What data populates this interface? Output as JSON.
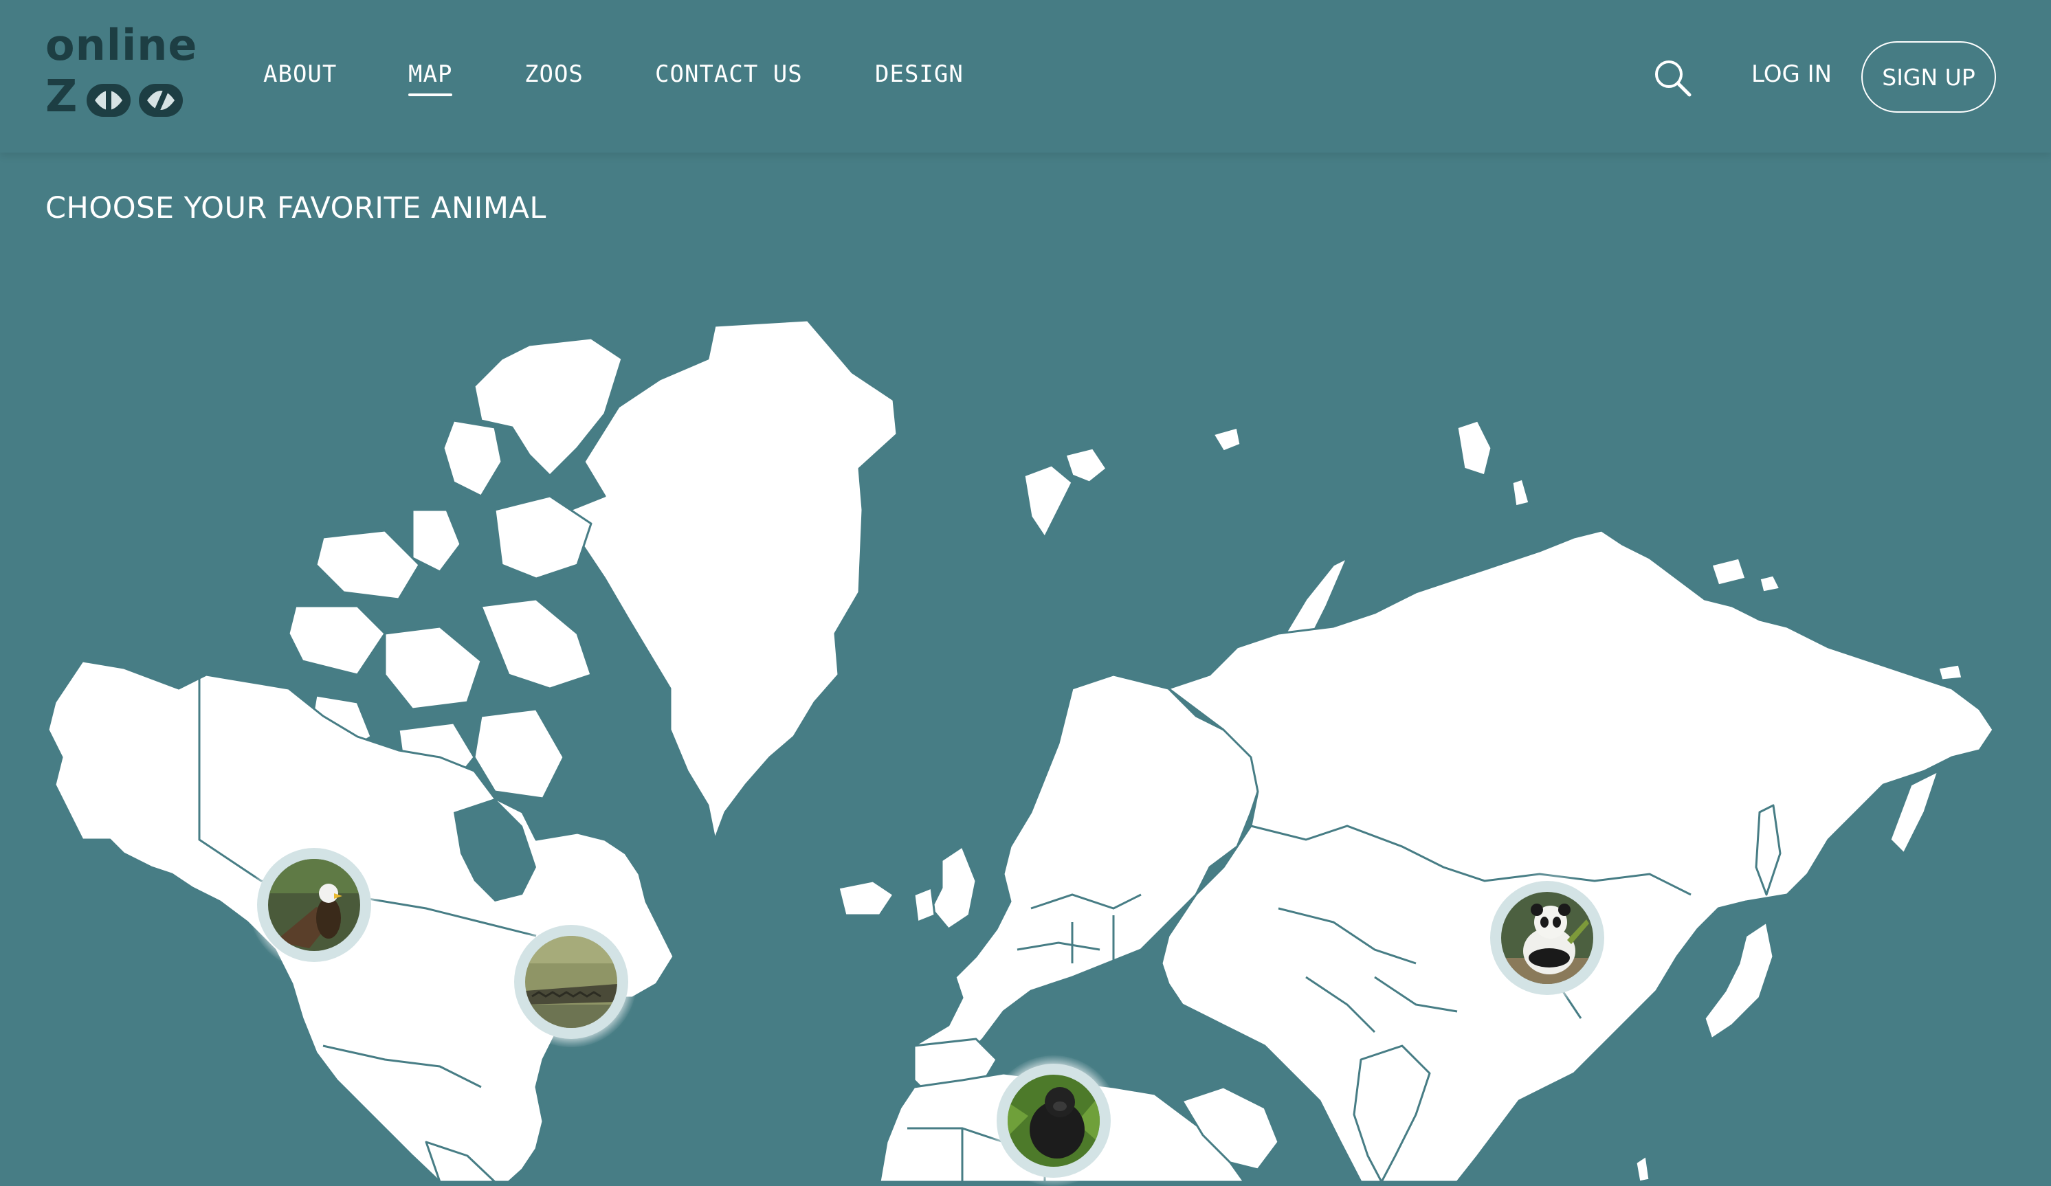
{
  "brand": {
    "word": "online",
    "mark_letter": "Z"
  },
  "nav": {
    "items": [
      {
        "label": "ABOUT",
        "active": false
      },
      {
        "label": "MAP",
        "active": true
      },
      {
        "label": "ZOOS",
        "active": false
      },
      {
        "label": "CONTACT US",
        "active": false
      },
      {
        "label": "DESIGN",
        "active": false
      }
    ]
  },
  "header_actions": {
    "search_icon": "search-icon",
    "login_label": "LOG IN",
    "signup_label": "SIGN UP"
  },
  "page": {
    "title": "CHOOSE YOUR FAVORITE ANIMAL"
  },
  "map_pins": [
    {
      "animal": "eagle",
      "region": "north-america-west"
    },
    {
      "animal": "alligator",
      "region": "north-america-east"
    },
    {
      "animal": "gorilla",
      "region": "africa"
    },
    {
      "animal": "panda",
      "region": "china"
    }
  ],
  "colors": {
    "background": "#477d85",
    "land": "#ffffff",
    "border": "#477d85",
    "logo": "#1d3e43",
    "pin_ring": "#d3e3e5"
  }
}
